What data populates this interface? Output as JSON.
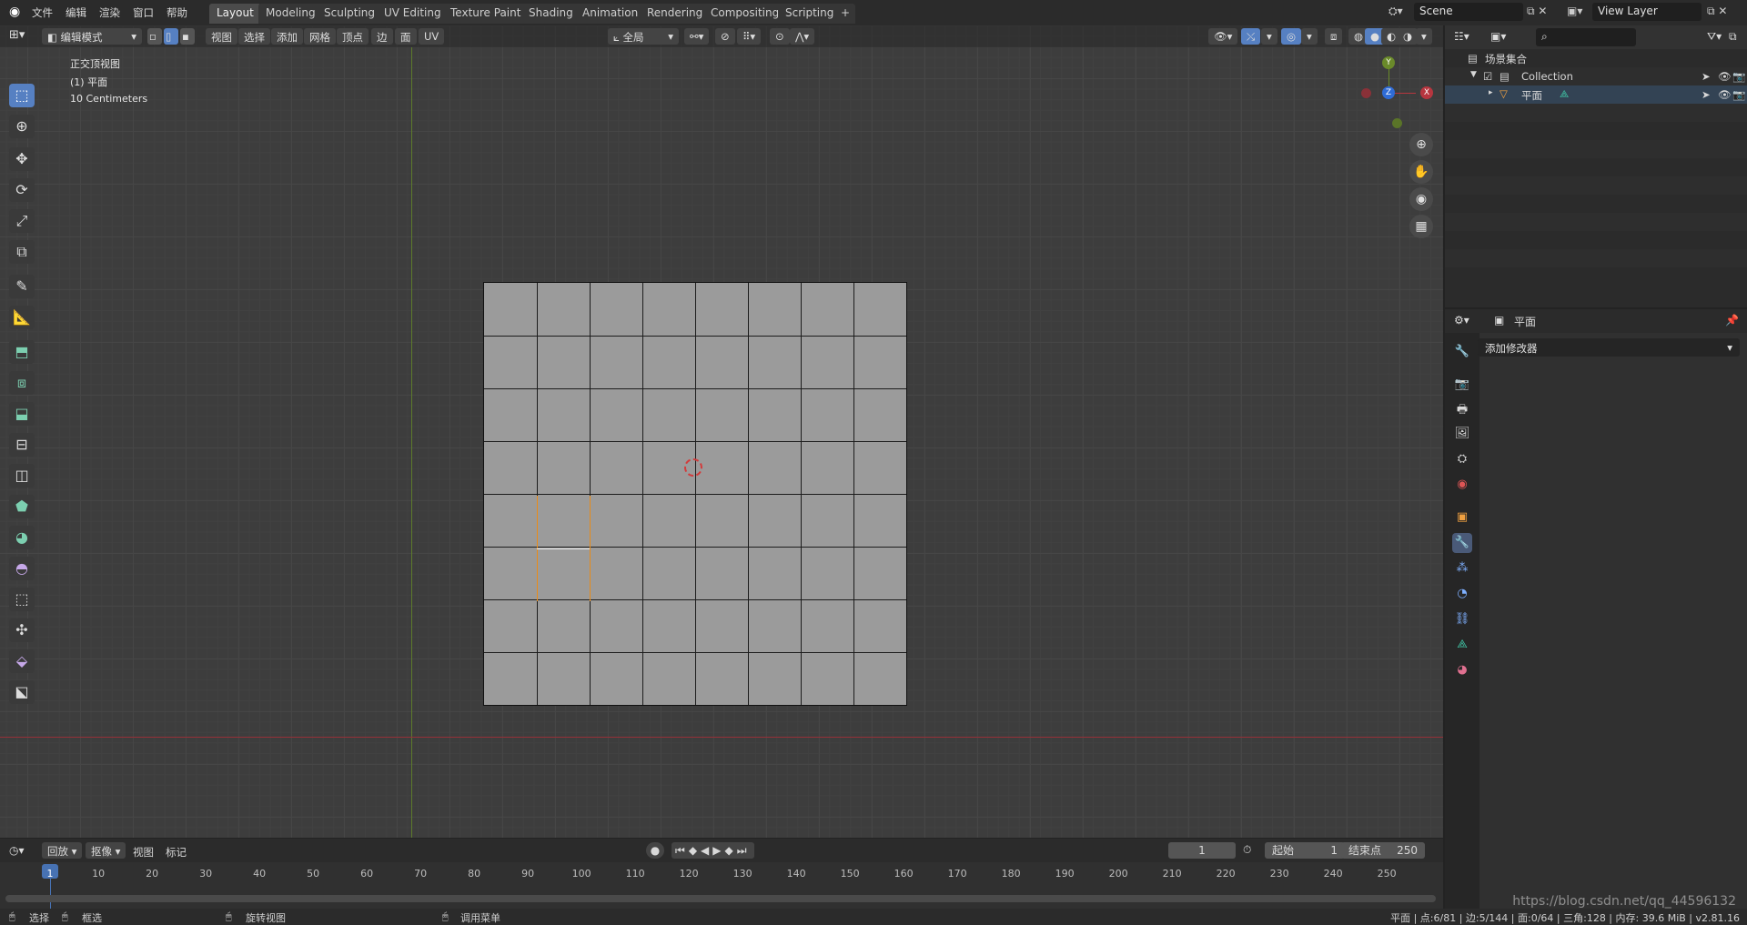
{
  "top_menu": [
    "文件",
    "编辑",
    "渲染",
    "窗口",
    "帮助"
  ],
  "workspace_tabs": [
    "Layout",
    "Modeling",
    "Sculpting",
    "UV Editing",
    "Texture Paint",
    "Shading",
    "Animation",
    "Rendering",
    "Compositing",
    "Scripting"
  ],
  "add_tab": "+",
  "scene_name": "Scene",
  "view_layer_name": "View Layer",
  "viewport": {
    "mode": "编辑模式",
    "header_menus": [
      "视图",
      "选择",
      "添加",
      "网格",
      "顶点",
      "边",
      "面",
      "UV"
    ],
    "transform_orientation": "全局",
    "overlay_line1": "正交顶视图",
    "overlay_line2": "(1) 平面",
    "overlay_line3": "10 Centimeters",
    "gizmo_y": "Y",
    "gizmo_z": "Z",
    "gizmo_x": "X",
    "mesh_grid": 8
  },
  "outliner": {
    "root": "场景集合",
    "collection": "Collection",
    "object": "平面"
  },
  "properties": {
    "object_name": "平面",
    "add_modifier": "添加修改器"
  },
  "timeline": {
    "playback": "回放",
    "keying": "抠像",
    "view": "视图",
    "marker": "标记",
    "current_frame": "1",
    "start_label": "起始",
    "start_value": "1",
    "end_label": "结束点",
    "end_value": "250",
    "ruler": [
      "1",
      "10",
      "20",
      "30",
      "40",
      "50",
      "60",
      "70",
      "80",
      "90",
      "100",
      "110",
      "120",
      "130",
      "140",
      "150",
      "160",
      "170",
      "180",
      "190",
      "200",
      "210",
      "220",
      "230",
      "240",
      "250"
    ]
  },
  "status": {
    "select": "选择",
    "box_select": "框选",
    "rotate_view": "旋转视图",
    "call_menu": "调用菜单",
    "stats": "平面 | 点:6/81 | 边:5/144 | 面:0/64 | 三角:128 | 内存: 39.6 MiB | v2.81.16",
    "watermark": "https://blog.csdn.net/qq_44596132"
  },
  "colors": {
    "accent": "#5680c2",
    "selected_edge": "#e88c1a",
    "x_axis": "#b7363f",
    "y_axis": "#6a8a2a"
  }
}
